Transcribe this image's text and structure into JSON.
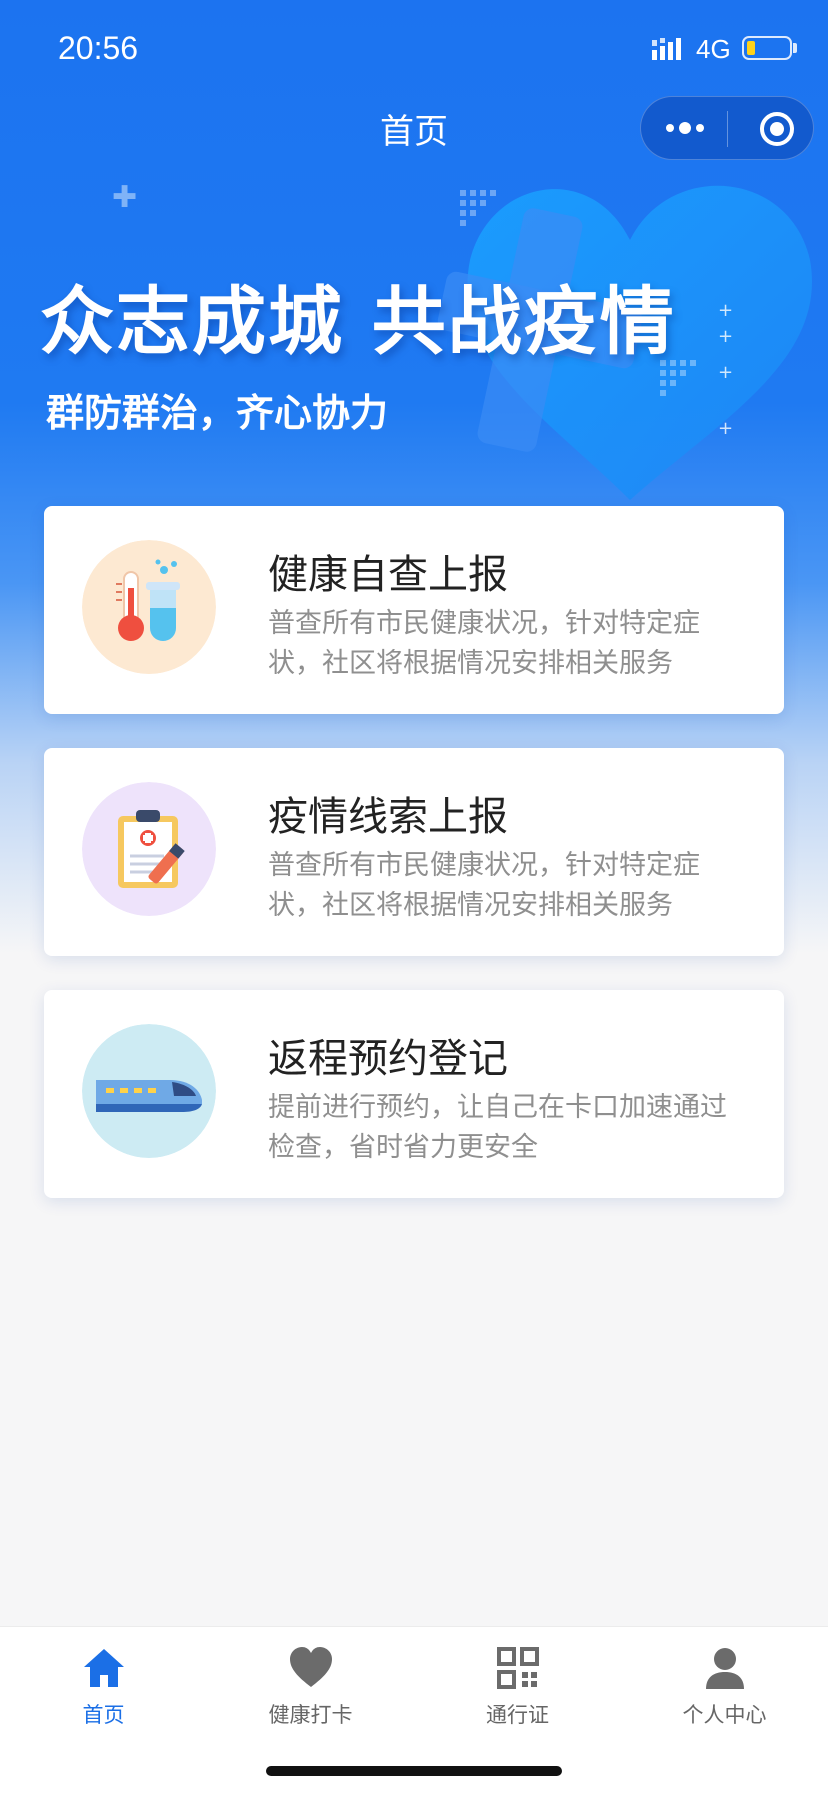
{
  "status_bar": {
    "time": "20:56",
    "network": "4G"
  },
  "nav": {
    "title": "首页"
  },
  "banner": {
    "title": "众志成城  共战疫情",
    "subtitle": "群防群治，齐心协力"
  },
  "cards": [
    {
      "title": "健康自查上报",
      "desc": "普查所有市民健康状况，针对特定症状，社区将根据情况安排相关服务",
      "icon": "thermometer-test-tube-icon"
    },
    {
      "title": "疫情线索上报",
      "desc": "普查所有市民健康状况，针对特定症状，社区将根据情况安排相关服务",
      "icon": "clipboard-pen-icon"
    },
    {
      "title": "返程预约登记",
      "desc": "提前进行预约，让自己在卡口加速通过检查，省时省力更安全",
      "icon": "bullet-train-icon"
    }
  ],
  "tabs": [
    {
      "label": "首页",
      "icon": "home-icon",
      "active": true
    },
    {
      "label": "健康打卡",
      "icon": "heart-icon",
      "active": false
    },
    {
      "label": "通行证",
      "icon": "qr-code-icon",
      "active": false
    },
    {
      "label": "个人中心",
      "icon": "user-icon",
      "active": false
    }
  ],
  "colors": {
    "primary": "#1c73f0",
    "tab_active": "#1b6fe6",
    "tab_inactive": "#666666"
  }
}
